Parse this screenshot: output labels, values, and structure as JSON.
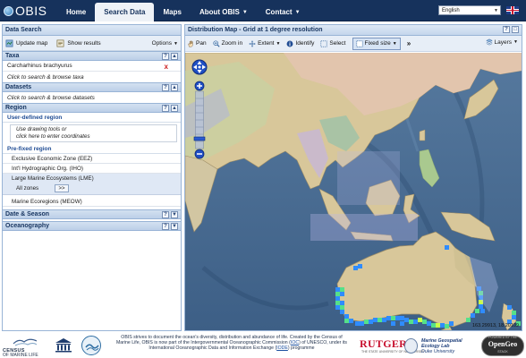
{
  "brand": {
    "logo_text": "OBIS"
  },
  "nav": {
    "items": [
      {
        "label": "Home",
        "active": false,
        "dropdown": false
      },
      {
        "label": "Search Data",
        "active": true,
        "dropdown": false
      },
      {
        "label": "Maps",
        "active": false,
        "dropdown": false
      },
      {
        "label": "About OBIS",
        "active": false,
        "dropdown": true
      },
      {
        "label": "Contact",
        "active": false,
        "dropdown": true
      }
    ],
    "language": {
      "selected": "English"
    },
    "flag_icon": "uk-flag-icon"
  },
  "left_panel": {
    "title": "Data Search",
    "toolbar": {
      "update_label": "Update map",
      "show_label": "Show results",
      "options_label": "Options"
    },
    "taxa": {
      "heading": "Taxa",
      "selected_taxon": "Carcharhinus brachyurus",
      "browse_hint": "Click to search & browse taxa"
    },
    "datasets": {
      "heading": "Datasets",
      "browse_hint": "Click to search & browse datasets"
    },
    "region": {
      "heading": "Region",
      "user_defined": {
        "heading": "User-defined region",
        "hint_line1": "Use drawing tools or",
        "hint_line2": "click here to enter coordinates"
      },
      "prefixed": {
        "heading": "Pre-fixed region",
        "zones": [
          "Exclusive Economic Zone (EEZ)",
          "Int'l Hydrographic Org. (IHO)",
          "Large Marine Ecosystems (LME)",
          "Marine Ecoregions (MEOW)"
        ],
        "selected_zone": "Large Marine Ecosystems (LME)",
        "lme_choice": "All zones",
        "lme_button": ">>"
      }
    },
    "date_season": {
      "heading": "Date & Season"
    },
    "oceanography": {
      "heading": "Oceanography"
    },
    "header_button_help": "?",
    "header_button_close": "x"
  },
  "map_panel": {
    "title": "Distribution Map - Grid at 1 degree resolution",
    "toolbar": {
      "pan": "Pan",
      "zoom_in": "Zoom in",
      "extent": "Extent",
      "identify": "Identify",
      "select": "Select",
      "fixed_size": "Fixed size",
      "more": "»",
      "layers": "Layers"
    },
    "coordinates": "163.29913, 18.20109",
    "colors": {
      "ocean": "#4a6d93",
      "land": "#d6c798",
      "record_low": "#2f8cff",
      "record_mid": "#55e08a",
      "record_high": "#c8ff4a"
    }
  },
  "footer": {
    "text_pre": "OBIS strives to document the ocean's diversity, distribution and abundance of life. Created by the Census of Marine Life, OBIS is now part of the Intergovernmental Oceanographic Commission (",
    "ioc_link": "IOC",
    "text_mid": ") of UNESCO, under its International Oceanographic Data and Information Exchange (",
    "iode_link": "IODE",
    "text_post": ") programme",
    "census_line1": "CENSUS",
    "census_line2": "OF MARINE LIFE",
    "rutgers": "RUTGERS",
    "rutgers_sub": "THE STATE UNIVERSITY OF NEW JERSEY",
    "mgel_line1": "Marine Geospatial",
    "mgel_line2": "Ecology Lab",
    "mgel_line3": "Duke University",
    "opengeo_top": "POWERED BY THE",
    "opengeo": "OpenGeo",
    "opengeo_bottom": "STACK"
  }
}
